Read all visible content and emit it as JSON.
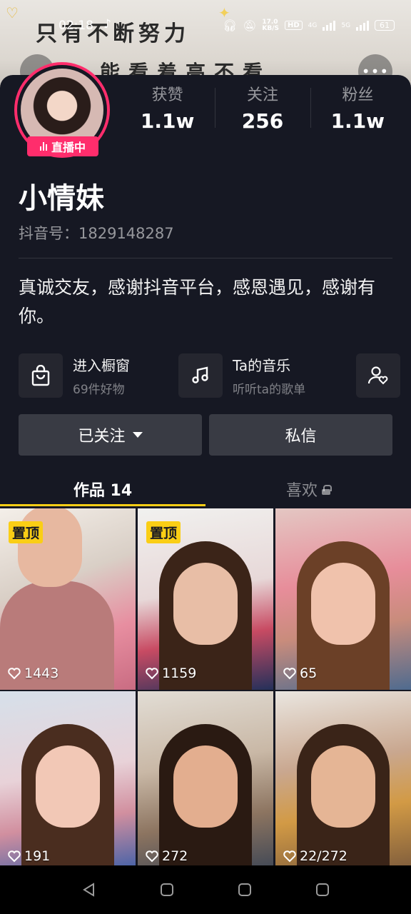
{
  "status_bar": {
    "time": "02:18",
    "net_speed": "17.0\nKB/S",
    "hd": "HD",
    "net_4g": "4G",
    "net_5g": "5G",
    "battery": "61"
  },
  "banner": {
    "line1": "只有不断努力",
    "line2": "能看着高不看"
  },
  "profile": {
    "live_badge": "直播中",
    "stats": [
      {
        "label": "获赞",
        "value": "1.1w"
      },
      {
        "label": "关注",
        "value": "256"
      },
      {
        "label": "粉丝",
        "value": "1.1w"
      }
    ],
    "username": "小情妹",
    "douyin_id": "抖音号：1829148287",
    "bio": "真诚交友，感谢抖音平台，感恩遇见，感谢有你。"
  },
  "shortcuts": {
    "shop_title": "进入橱窗",
    "shop_sub": "69件好物",
    "music_title": "Ta的音乐",
    "music_sub": "听听ta的歌单"
  },
  "actions": {
    "followed": "已关注",
    "message": "私信"
  },
  "tabs": {
    "works": "作品 14",
    "likes": "喜欢"
  },
  "videos": [
    {
      "pinned": "置顶",
      "likes": "1443"
    },
    {
      "pinned": "置顶",
      "likes": "1159"
    },
    {
      "pinned": "",
      "likes": "65"
    },
    {
      "pinned": "",
      "likes": "191"
    },
    {
      "pinned": "",
      "likes": "272"
    },
    {
      "pinned": "",
      "likes": "22/272"
    }
  ],
  "colors": {
    "background": "#161823",
    "live_pink": "#ff2d6c",
    "accent_yellow": "#face15",
    "button_gray": "#393b44"
  }
}
